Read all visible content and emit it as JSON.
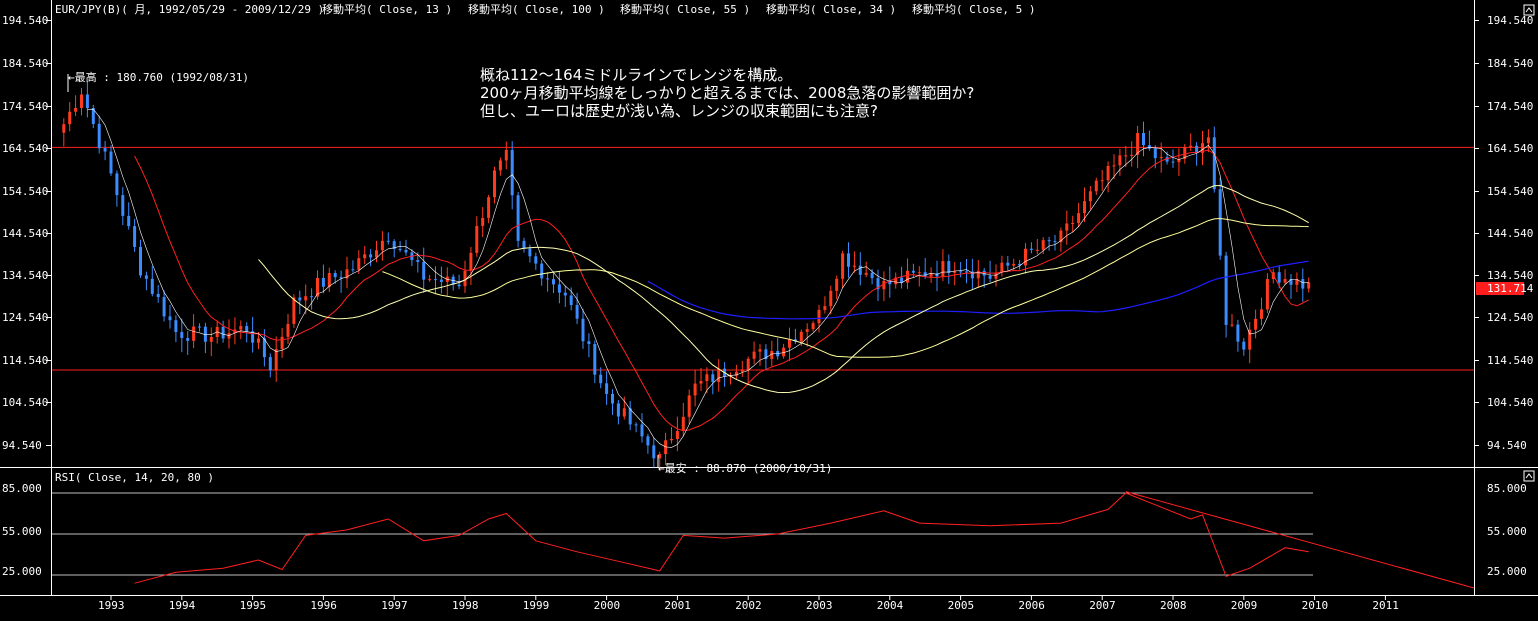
{
  "header": {
    "symbol": "EUR/JPY(B)( 月, 1992/05/29 - 2009/12/29 )",
    "ma_labels": [
      "移動平均( Close, 13 )",
      "移動平均( Close, 100 )",
      "移動平均( Close, 55 )",
      "移動平均( Close, 34 )",
      "移動平均( Close, 5 )"
    ]
  },
  "annotation": {
    "lines": [
      "概ね112～164ミドルラインでレンジを構成。",
      "200ヶ月移動平均線をしっかりと超えるまでは、2008急落の影響範囲か?",
      "但し、ユーロは歴史が浅い為、レンジの収束範囲にも注意?"
    ],
    "high_label": "←最高 : 180.760 (1992/08/31)",
    "low_label": "←最安 : 88.870 (2000/10/31)"
  },
  "price_axis": {
    "ticks": [
      "194.540",
      "184.540",
      "174.540",
      "164.540",
      "154.540",
      "144.540",
      "134.540",
      "124.540",
      "114.540",
      "104.540",
      "94.540"
    ],
    "current_value": "131.714"
  },
  "rsi_panel": {
    "title": "RSI( Close, 14, 20, 80 )",
    "ticks": [
      "85.000",
      "55.000",
      "25.000"
    ]
  },
  "time_axis": {
    "years": [
      "1993",
      "1994",
      "1995",
      "1996",
      "1997",
      "1998",
      "1999",
      "2000",
      "2001",
      "2002",
      "2003",
      "2004",
      "2005",
      "2006",
      "2007",
      "2008",
      "2009",
      "2010",
      "2011"
    ]
  },
  "colors": {
    "background": "#000000",
    "up_candle": "#ff3b1e",
    "down_candle": "#3a8cff",
    "ma13": "#ff2020",
    "ma100": "#1e1eff",
    "ma55": "#ffff9a",
    "ma34": "#ffffb0",
    "ma5": "#ffffff",
    "hline": "#ff2020",
    "rsi_line": "#ff2020",
    "trendline": "#ff2020",
    "current_box": "#ff1e1e"
  },
  "chart_data": [
    {
      "type": "candlestick",
      "title": "EUR/JPY(B)( 月, 1992/05/29 - 2009/12/29 )",
      "x_range": [
        "1992-05",
        "2011-12"
      ],
      "ylim": [
        88,
        196
      ],
      "ohlc_anchor_closes": [
        {
          "date": "1992-05",
          "close": 170
        },
        {
          "date": "1992-08",
          "close": 178
        },
        {
          "date": "1993-01",
          "close": 158
        },
        {
          "date": "1993-06",
          "close": 136
        },
        {
          "date": "1993-12",
          "close": 121
        },
        {
          "date": "1994-06",
          "close": 120
        },
        {
          "date": "1994-12",
          "close": 122
        },
        {
          "date": "1995-04",
          "close": 113
        },
        {
          "date": "1995-08",
          "close": 128
        },
        {
          "date": "1995-12",
          "close": 132
        },
        {
          "date": "1996-06",
          "close": 136
        },
        {
          "date": "1996-12",
          "close": 144
        },
        {
          "date": "1997-06",
          "close": 134
        },
        {
          "date": "1997-12",
          "close": 132
        },
        {
          "date": "1998-06",
          "close": 158
        },
        {
          "date": "1998-08",
          "close": 162
        },
        {
          "date": "1998-10",
          "close": 141
        },
        {
          "date": "1999-06",
          "close": 130
        },
        {
          "date": "2000-01",
          "close": 106
        },
        {
          "date": "2000-10",
          "close": 91
        },
        {
          "date": "2001-04",
          "close": 108
        },
        {
          "date": "2001-12",
          "close": 114
        },
        {
          "date": "2002-06",
          "close": 117
        },
        {
          "date": "2003-01",
          "close": 125
        },
        {
          "date": "2003-05",
          "close": 139
        },
        {
          "date": "2003-12",
          "close": 132
        },
        {
          "date": "2004-12",
          "close": 137
        },
        {
          "date": "2005-06",
          "close": 134
        },
        {
          "date": "2005-12",
          "close": 139
        },
        {
          "date": "2006-06",
          "close": 143
        },
        {
          "date": "2006-12",
          "close": 155
        },
        {
          "date": "2007-07",
          "close": 166
        },
        {
          "date": "2007-12",
          "close": 160
        },
        {
          "date": "2008-07",
          "close": 167
        },
        {
          "date": "2008-10",
          "close": 124
        },
        {
          "date": "2009-01",
          "close": 118
        },
        {
          "date": "2009-06",
          "close": 135
        },
        {
          "date": "2009-12",
          "close": 131.714
        }
      ],
      "horizontal_lines": [
        164.5,
        112
      ],
      "series": [
        {
          "name": "移動平均( Close, 13 )"
        },
        {
          "name": "移動平均( Close, 100 )"
        },
        {
          "name": "移動平均( Close, 55 )"
        },
        {
          "name": "移動平均( Close, 34 )"
        },
        {
          "name": "移動平均( Close, 5 )"
        }
      ],
      "annotations": [
        {
          "text": "←最高 : 180.760 (1992/08/31)",
          "date": "1992-08",
          "value": 180.76
        },
        {
          "text": "←最安 : 88.870 (2000/10/31)",
          "date": "2000-10",
          "value": 88.87
        }
      ]
    },
    {
      "type": "line",
      "title": "RSI( Close, 14, 20, 80 )",
      "ylim": [
        15,
        92
      ],
      "levels": [
        85,
        55,
        25
      ],
      "x": [
        "1993-05",
        "1993-12",
        "1994-08",
        "1995-02",
        "1995-06",
        "1995-10",
        "1996-05",
        "1996-12",
        "1997-06",
        "1997-12",
        "1998-05",
        "1998-08",
        "1999-01",
        "1999-08",
        "2000-03",
        "2000-10",
        "2001-02",
        "2001-09",
        "2002-06",
        "2003-03",
        "2003-12",
        "2004-06",
        "2005-06",
        "2006-06",
        "2007-02",
        "2007-05",
        "2008-04",
        "2008-06",
        "2008-10",
        "2009-02",
        "2009-08",
        "2009-12"
      ],
      "values": [
        19,
        27,
        30,
        36,
        29,
        54,
        58,
        66,
        50,
        54,
        66,
        70,
        50,
        42,
        35,
        28,
        54,
        52,
        55,
        63,
        72,
        63,
        61,
        63,
        73,
        85,
        66,
        69,
        24,
        30,
        45,
        42
      ],
      "trendline": {
        "from": {
          "date": "2007-05",
          "value": 86
        },
        "to": {
          "date": "2011-12",
          "value": 17
        }
      }
    }
  ]
}
